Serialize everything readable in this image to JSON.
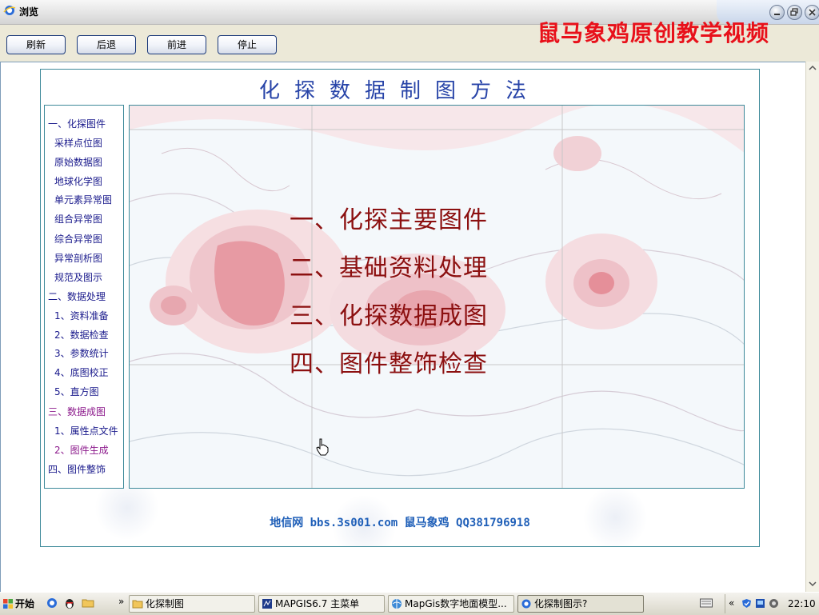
{
  "window": {
    "title": "浏览",
    "watermark": "鼠马象鸡原创教学视频"
  },
  "toolbar": {
    "refresh": "刷新",
    "back": "后退",
    "forward": "前进",
    "stop": "停止"
  },
  "page": {
    "title": "化探数据制图方法",
    "nav": [
      {
        "label": "一、化探图件",
        "level": "top"
      },
      {
        "label": "采样点位图",
        "level": "sub"
      },
      {
        "label": "原始数据图",
        "level": "sub"
      },
      {
        "label": "地球化学图",
        "level": "sub"
      },
      {
        "label": "单元素异常图",
        "level": "sub"
      },
      {
        "label": "组合异常图",
        "level": "sub"
      },
      {
        "label": "综合异常图",
        "level": "sub"
      },
      {
        "label": "异常剖析图",
        "level": "sub"
      },
      {
        "label": "规范及图示",
        "level": "sub"
      },
      {
        "label": "二、数据处理",
        "level": "top"
      },
      {
        "label": "1、资料准备",
        "level": "sub"
      },
      {
        "label": "2、数据检查",
        "level": "sub"
      },
      {
        "label": "3、参数统计",
        "level": "sub"
      },
      {
        "label": "4、底图校正",
        "level": "sub"
      },
      {
        "label": "5、直方图",
        "level": "sub"
      },
      {
        "label": "三、数据成图",
        "level": "top",
        "visited": true
      },
      {
        "label": "1、属性点文件",
        "level": "sub"
      },
      {
        "label": "2、图件生成",
        "level": "sub",
        "visited": true
      },
      {
        "label": "四、图件整饰",
        "level": "top"
      }
    ],
    "menu": [
      "一、化探主要图件",
      "二、基础资料处理",
      "三、化探数据成图",
      "四、图件整饰检查"
    ],
    "footer": "地信网 bbs.3s001.com 鼠马象鸡 QQ381796918"
  },
  "taskbar": {
    "start": "开始",
    "overflow": "»",
    "tasks": [
      {
        "label": "化探制图",
        "icon": "folder-icon"
      },
      {
        "label": "MAPGIS6.7 主菜单",
        "icon": "mapgis-icon"
      },
      {
        "label": "MapGis数字地面模型...",
        "icon": "globe-icon"
      },
      {
        "label": "化探制图示?",
        "icon": "ie-icon",
        "active": true
      }
    ],
    "tray_overflow": "«",
    "clock": "22:10"
  },
  "colors": {
    "title_blue": "#2844a8",
    "menu_red": "#8c1010",
    "watermark_red": "#e8101a",
    "link_blue": "#1a1a8c",
    "visited_purple": "#8c1a8c"
  }
}
